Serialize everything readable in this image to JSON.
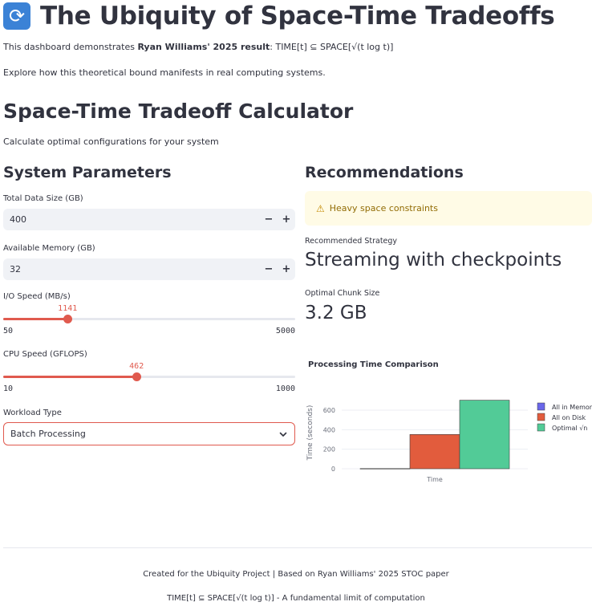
{
  "header": {
    "icon": "refresh-arrows-icon",
    "title": "The Ubiquity of Space-Time Tradeoffs"
  },
  "intro": {
    "line1_prefix": "This dashboard demonstrates ",
    "line1_bold": "Ryan Williams' 2025 result",
    "line1_suffix": ": TIME[t] ⊆ SPACE[√(t log t)]",
    "line2": "Explore how this theoretical bound manifests in real computing systems."
  },
  "calculator": {
    "title": "Space-Time Tradeoff Calculator",
    "subtitle": "Calculate optimal configurations for your system"
  },
  "params": {
    "title": "System Parameters",
    "data_size": {
      "label": "Total Data Size (GB)",
      "value": "400",
      "minus": "−",
      "plus": "+"
    },
    "memory": {
      "label": "Available Memory (GB)",
      "value": "32",
      "minus": "−",
      "plus": "+"
    },
    "io_speed": {
      "label": "I/O Speed (MB/s)",
      "value": 1141,
      "value_text": "1141",
      "min": 50,
      "min_text": "50",
      "max": 5000,
      "max_text": "5000"
    },
    "cpu_speed": {
      "label": "CPU Speed (GFLOPS)",
      "value": 462,
      "value_text": "462",
      "min": 10,
      "min_text": "10",
      "max": 1000,
      "max_text": "1000"
    },
    "workload": {
      "label": "Workload Type",
      "value": "Batch Processing"
    }
  },
  "recommendations": {
    "title": "Recommendations",
    "warning": "Heavy space constraints",
    "strategy_label": "Recommended Strategy",
    "strategy_value": "Streaming with checkpoints",
    "chunk_label": "Optimal Chunk Size",
    "chunk_value": "3.2 GB"
  },
  "colors": {
    "accent": "#e05a4e",
    "memory": "#6a67ea",
    "disk": "#e25c3d",
    "sqrt": "#52cb97"
  },
  "chart_data": {
    "type": "bar",
    "title": "Processing Time Comparison",
    "categories": [
      "Time"
    ],
    "series": [
      {
        "name": "All in Memory",
        "values": [
          2
        ]
      },
      {
        "name": "All on Disk",
        "values": [
          351
        ]
      },
      {
        "name": "Optimal √n",
        "values": [
          702
        ]
      }
    ],
    "xlabel": "",
    "ylabel": "Time (seconds)",
    "yticks": [
      0,
      200,
      400,
      600
    ],
    "ylim": [
      0,
      740
    ],
    "legend": "right",
    "grid": true
  },
  "footer": {
    "line1": "Created for the Ubiquity Project | Based on Ryan Williams' 2025 STOC paper",
    "line2": "TIME[t] ⊆ SPACE[√(t log t)] - A fundamental limit of computation"
  }
}
